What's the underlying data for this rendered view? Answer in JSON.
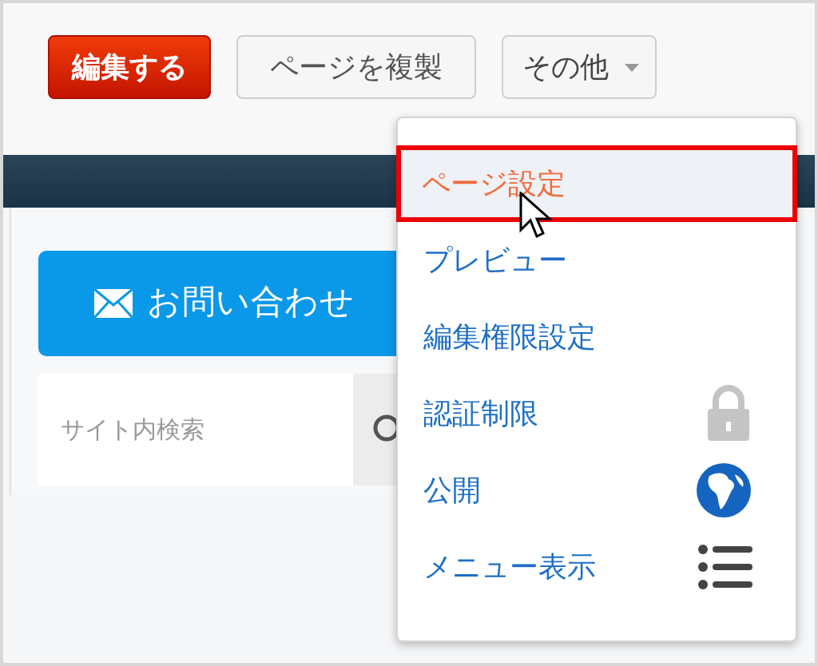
{
  "toolbar": {
    "buttons": [
      {
        "label": "編集する",
        "kind": "primary"
      },
      {
        "label": "ページを複製",
        "kind": "default"
      },
      {
        "label": "その他",
        "kind": "dropdown"
      }
    ]
  },
  "content": {
    "contact_button": "お問い合わせ",
    "search": {
      "placeholder": "サイト内検索"
    }
  },
  "menu": {
    "items": [
      {
        "label": "ページ設定",
        "selected": true,
        "kind": "plain"
      },
      {
        "label": "プレビュー",
        "selected": false,
        "kind": "plain"
      },
      {
        "label": "編集権限設定",
        "selected": false,
        "kind": "plain"
      },
      {
        "label": "認証制限",
        "selected": false,
        "kind": "lock"
      },
      {
        "label": "公開",
        "selected": false,
        "kind": "globe"
      },
      {
        "label": "メニュー表示",
        "selected": false,
        "kind": "list"
      }
    ]
  }
}
